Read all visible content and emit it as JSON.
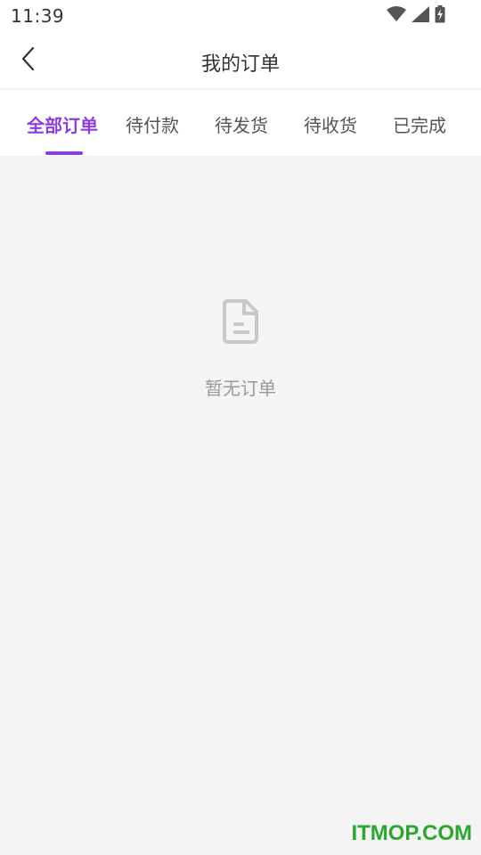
{
  "status_bar": {
    "time": "11:39",
    "icons": [
      "wifi-icon",
      "signal-icon",
      "battery-charging-icon"
    ]
  },
  "header": {
    "title": "我的订单",
    "back_icon": "chevron-left-icon"
  },
  "tabs": [
    {
      "label": "全部订单",
      "active": true
    },
    {
      "label": "待付款",
      "active": false
    },
    {
      "label": "待发货",
      "active": false
    },
    {
      "label": "待收货",
      "active": false
    },
    {
      "label": "已完成",
      "active": false
    }
  ],
  "empty_state": {
    "icon": "document-icon",
    "text": "暂无订单"
  },
  "watermark": "ITMOP.COM",
  "colors": {
    "accent": "#8a3ee0",
    "background": "#f4f4f5",
    "icon_gray": "#c8c8c8",
    "watermark": "#2aa82e"
  }
}
